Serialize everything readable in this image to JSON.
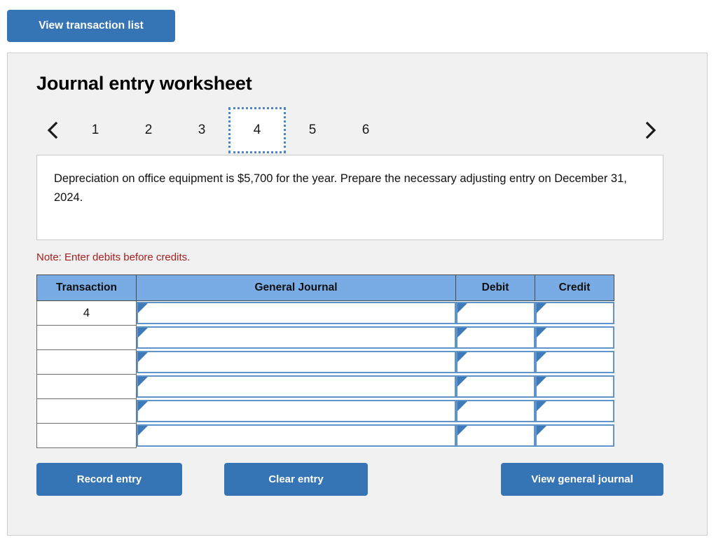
{
  "top": {
    "view_transaction_list_label": "View transaction list"
  },
  "worksheet": {
    "title": "Journal entry worksheet",
    "prev_arrow_icon": "chevron-left-icon",
    "next_arrow_icon": "chevron-right-icon",
    "tabs": [
      {
        "label": "1",
        "active": false
      },
      {
        "label": "2",
        "active": false
      },
      {
        "label": "3",
        "active": false
      },
      {
        "label": "4",
        "active": true
      },
      {
        "label": "5",
        "active": false
      },
      {
        "label": "6",
        "active": false
      }
    ],
    "description": "Depreciation on office equipment is $5,700 for the year. Prepare the necessary adjusting entry on December 31, 2024.",
    "note": "Note: Enter debits before credits."
  },
  "table": {
    "headers": {
      "transaction": "Transaction",
      "general_journal": "General Journal",
      "debit": "Debit",
      "credit": "Credit"
    },
    "rows": [
      {
        "transaction": "4",
        "general_journal": "",
        "debit": "",
        "credit": ""
      },
      {
        "transaction": "",
        "general_journal": "",
        "debit": "",
        "credit": ""
      },
      {
        "transaction": "",
        "general_journal": "",
        "debit": "",
        "credit": ""
      },
      {
        "transaction": "",
        "general_journal": "",
        "debit": "",
        "credit": ""
      },
      {
        "transaction": "",
        "general_journal": "",
        "debit": "",
        "credit": ""
      },
      {
        "transaction": "",
        "general_journal": "",
        "debit": "",
        "credit": ""
      }
    ]
  },
  "footer": {
    "record_entry_label": "Record entry",
    "clear_entry_label": "Clear entry",
    "view_general_journal_label": "View general journal"
  },
  "colors": {
    "button_blue": "#3575b5",
    "header_blue": "#79ace5",
    "input_border_blue": "#5f94cb",
    "active_tab_border": "#4a86c8",
    "note_red": "#a81f1f",
    "panel_bg": "#f1f1f1"
  }
}
